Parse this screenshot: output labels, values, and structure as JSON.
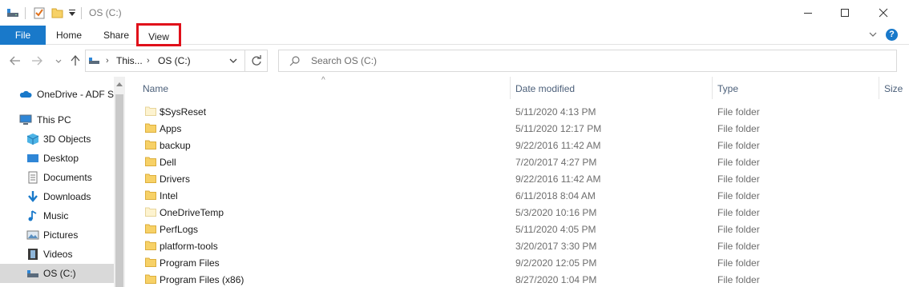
{
  "titlebar": {
    "title": "OS (C:)",
    "window_controls": [
      "minimize-icon",
      "maximize-icon",
      "close-icon"
    ]
  },
  "ribbon": {
    "tabs": [
      {
        "label": "File"
      },
      {
        "label": "Home"
      },
      {
        "label": "Share"
      },
      {
        "label": "View"
      }
    ],
    "help": "?"
  },
  "address": {
    "segments": [
      "This...",
      "OS (C:)"
    ]
  },
  "search": {
    "placeholder": "Search OS (C:)"
  },
  "navpane": {
    "items": [
      {
        "label": "OneDrive - ADF Sc",
        "icon": "cloud-icon"
      },
      {
        "label": "This PC",
        "icon": "computer-icon"
      },
      {
        "label": "3D Objects",
        "icon": "cube-icon"
      },
      {
        "label": "Desktop",
        "icon": "desktop-icon"
      },
      {
        "label": "Documents",
        "icon": "documents-icon"
      },
      {
        "label": "Downloads",
        "icon": "download-icon"
      },
      {
        "label": "Music",
        "icon": "music-icon"
      },
      {
        "label": "Pictures",
        "icon": "pictures-icon"
      },
      {
        "label": "Videos",
        "icon": "videos-icon"
      },
      {
        "label": "OS (C:)",
        "icon": "drive-icon"
      }
    ]
  },
  "columns": {
    "name": "Name",
    "date": "Date modified",
    "type": "Type",
    "size": "Size"
  },
  "files": [
    {
      "name": "$SysReset",
      "date": "5/11/2020 4:13 PM",
      "type": "File folder"
    },
    {
      "name": "Apps",
      "date": "5/11/2020 12:17 PM",
      "type": "File folder"
    },
    {
      "name": "backup",
      "date": "9/22/2016 11:42 AM",
      "type": "File folder"
    },
    {
      "name": "Dell",
      "date": "7/20/2017 4:27 PM",
      "type": "File folder"
    },
    {
      "name": "Drivers",
      "date": "9/22/2016 11:42 AM",
      "type": "File folder"
    },
    {
      "name": "Intel",
      "date": "6/11/2018 8:04 AM",
      "type": "File folder"
    },
    {
      "name": "OneDriveTemp",
      "date": "5/3/2020 10:16 PM",
      "type": "File folder"
    },
    {
      "name": "PerfLogs",
      "date": "5/11/2020 4:05 PM",
      "type": "File folder"
    },
    {
      "name": "platform-tools",
      "date": "3/20/2017 3:30 PM",
      "type": "File folder"
    },
    {
      "name": "Program Files",
      "date": "9/2/2020 12:05 PM",
      "type": "File folder"
    },
    {
      "name": "Program Files (x86)",
      "date": "8/27/2020 1:04 PM",
      "type": "File folder"
    }
  ],
  "colors": {
    "accent": "#1979ca",
    "highlight_box": "#e0101a",
    "folder": "#f7d167",
    "selected_nav": "#d9d9d9"
  }
}
